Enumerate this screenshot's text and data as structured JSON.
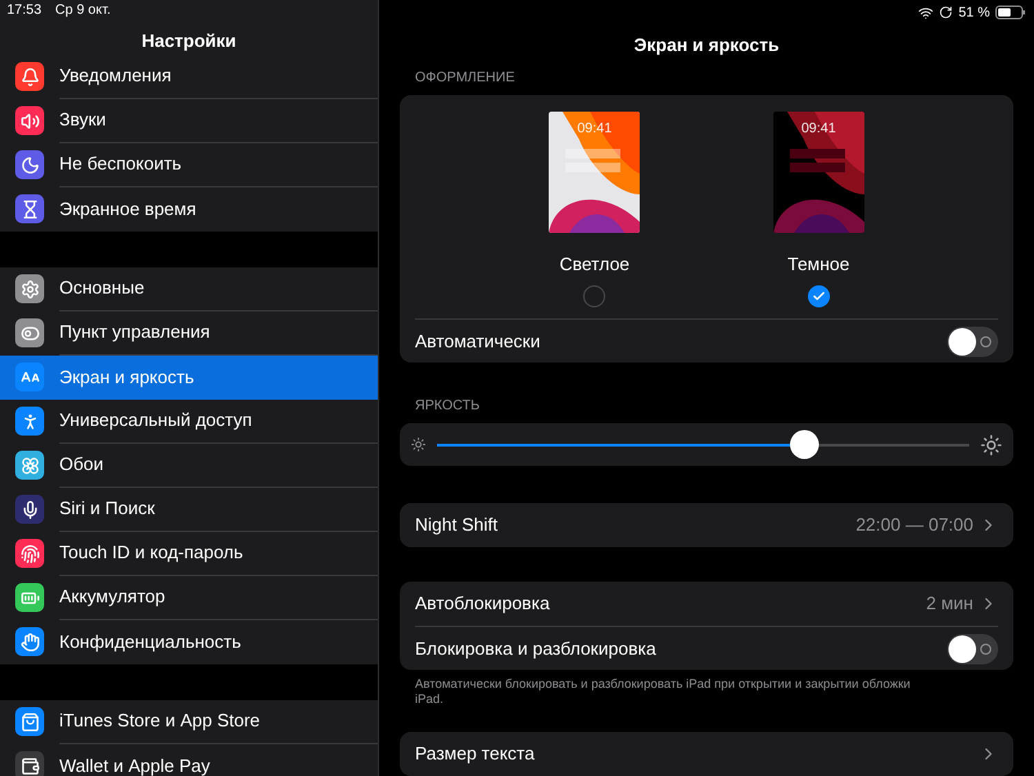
{
  "status_bar": {
    "time": "17:53",
    "date": "Ср 9 окт.",
    "battery": "51 %"
  },
  "sidebar": {
    "title": "Настройки",
    "groups": [
      {
        "items": [
          {
            "label": "Уведомления",
            "color": "#ff3b30",
            "selected": false
          },
          {
            "label": "Звуки",
            "color": "#ff2d55",
            "selected": false
          },
          {
            "label": "Не беспокоить",
            "color": "#5e5ce6",
            "selected": false
          },
          {
            "label": "Экранное время",
            "color": "#5e5ce6",
            "selected": false
          }
        ]
      },
      {
        "items": [
          {
            "label": "Основные",
            "color": "#8e8e93",
            "selected": false
          },
          {
            "label": "Пункт управления",
            "color": "#8e8e93",
            "selected": false
          },
          {
            "label": "Экран и яркость",
            "color": "#0a84ff",
            "selected": true
          },
          {
            "label": "Универсальный доступ",
            "color": "#0a84ff",
            "selected": false
          },
          {
            "label": "Обои",
            "color": "#30b0e0",
            "selected": false
          },
          {
            "label": "Siri и Поиск",
            "color": "#2c2c6e",
            "selected": false
          },
          {
            "label": "Touch ID и код-пароль",
            "color": "#ff2d55",
            "selected": false
          },
          {
            "label": "Аккумулятор",
            "color": "#34c759",
            "selected": false
          },
          {
            "label": "Конфиденциальность",
            "color": "#0a84ff",
            "selected": false
          }
        ]
      },
      {
        "items": [
          {
            "label": "iTunes Store и App Store",
            "color": "#0a84ff",
            "selected": false
          },
          {
            "label": "Wallet и Apple Pay",
            "color": "#3a3a3c",
            "selected": false
          }
        ]
      }
    ]
  },
  "detail": {
    "title": "Экран и яркость",
    "appearance": {
      "header": "ОФОРМЛЕНИЕ",
      "options": [
        {
          "kind": "light",
          "time": "09:41",
          "label": "Светлое",
          "selected": false
        },
        {
          "kind": "dark",
          "time": "09:41",
          "label": "Темное",
          "selected": true
        }
      ],
      "auto": {
        "label": "Автоматически",
        "on": false
      }
    },
    "brightness": {
      "header": "ЯРКОСТЬ",
      "level": 0.69
    },
    "night_shift": {
      "label": "Night Shift",
      "value": "22:00 — 07:00"
    },
    "lock": {
      "rows": [
        {
          "kind": "link",
          "label": "Автоблокировка",
          "value": "2 мин"
        },
        {
          "kind": "toggle",
          "label": "Блокировка и разблокировка",
          "on": false
        }
      ],
      "footnote": "Автоматически блокировать и разблокировать iPad при открытии и закрытии обложки iPad."
    },
    "text_size": {
      "label": "Размер текста"
    }
  }
}
